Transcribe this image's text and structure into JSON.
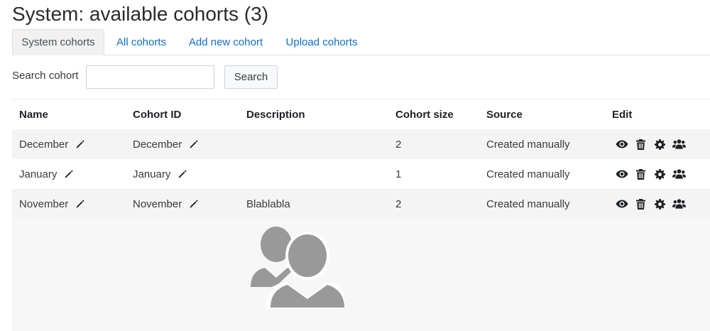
{
  "page": {
    "title": "System: available cohorts (3)"
  },
  "tabs": [
    {
      "label": "System cohorts",
      "active": true
    },
    {
      "label": "All cohorts",
      "active": false
    },
    {
      "label": "Add new cohort",
      "active": false
    },
    {
      "label": "Upload cohorts",
      "active": false
    }
  ],
  "search": {
    "label": "Search cohort",
    "value": "",
    "placeholder": "",
    "button": "Search"
  },
  "table": {
    "headers": [
      "Name",
      "Cohort ID",
      "Description",
      "Cohort size",
      "Source",
      "Edit"
    ],
    "rows": [
      {
        "name": "December",
        "cohort_id": "December",
        "description": "",
        "size": "2",
        "source": "Created manually"
      },
      {
        "name": "January",
        "cohort_id": "January",
        "description": "",
        "size": "1",
        "source": "Created manually"
      },
      {
        "name": "November",
        "cohort_id": "November",
        "description": "Blablabla",
        "size": "2",
        "source": "Created manually"
      }
    ]
  },
  "icons": {
    "edit": "pencil-icon",
    "actions": [
      "eye-icon",
      "trash-icon",
      "gear-icon",
      "users-icon"
    ],
    "illustration": "users-icon"
  },
  "colors": {
    "link": "#0f6fc5",
    "icon": "#1d2125",
    "illustration": "#999999"
  }
}
